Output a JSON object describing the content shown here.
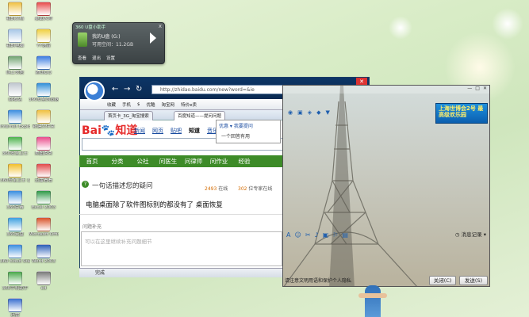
{
  "desktop": {
    "icons": [
      {
        "label": "我的文档",
        "color": "#f0c040",
        "icon": "folder-icon"
      },
      {
        "label": "桌面大师",
        "color": "#e84a4a",
        "icon": "app-icon"
      },
      {
        "label": "我的电脑",
        "color": "#a7c7e7",
        "icon": "computer-icon"
      },
      {
        "label": "YY语音",
        "color": "#f0d040",
        "icon": "yy-icon"
      },
      {
        "label": "网上邻居",
        "color": "#6fa36f",
        "icon": "network-icon"
      },
      {
        "label": "腾讯QQ",
        "color": "#3a7be0",
        "icon": "qq-icon"
      },
      {
        "label": "回收站",
        "color": "#c0c8d0",
        "icon": "recycle-bin-icon"
      },
      {
        "label": "360安全浏览器",
        "color": "#2f8fd8",
        "icon": "browser-icon"
      },
      {
        "label": "Internet Explorer",
        "color": "#3c8fe0",
        "icon": "ie-icon"
      },
      {
        "label": "新建文件夹",
        "color": "#f0c040",
        "icon": "folder-icon"
      },
      {
        "label": "360安全卫士",
        "color": "#4db34d",
        "icon": "shield-icon"
      },
      {
        "label": "美图秀秀",
        "color": "#e94c8b",
        "icon": "meitu-icon"
      },
      {
        "label": "360安全卫士 (2)",
        "color": "#f2c02c",
        "icon": "shield-icon"
      },
      {
        "label": "迅雷看看",
        "color": "#e24b4b",
        "icon": "video-icon"
      },
      {
        "label": "360杀毒",
        "color": "#3a8ee0",
        "icon": "antivirus-icon"
      },
      {
        "label": "Excel 2003",
        "color": "#2f9a49",
        "icon": "excel-icon"
      },
      {
        "label": "360云盘",
        "color": "#3da0e0",
        "icon": "cloud-icon"
      },
      {
        "label": "Microsoft Office Po...",
        "color": "#d9542b",
        "icon": "powerpoint-icon"
      },
      {
        "label": "360 cloud Start",
        "color": "#3a8ee0",
        "icon": "cloud-icon"
      },
      {
        "label": "Word 2003",
        "color": "#2b5fb8",
        "icon": "word-icon"
      },
      {
        "label": "360手机助手",
        "color": "#49a84a",
        "icon": "phone-icon"
      },
      {
        "label": "ed",
        "color": "#7a7a7a",
        "icon": "app-icon"
      },
      {
        "label": "迅雷",
        "color": "#3a6fd0",
        "icon": "thunder-icon"
      }
    ]
  },
  "widget": {
    "title": "360 U盘小助手",
    "close": "x",
    "disk_name": "我的U盘 (G:)",
    "disk_space": "可用空间：11.2GB",
    "buttons": [
      "查看",
      "退出",
      "设置"
    ]
  },
  "browser": {
    "url": "http://zhidao.baidu.com/new?word=&ie",
    "nav_back": "←",
    "nav_forward": "→",
    "nav_refresh": "↻",
    "close": "✕",
    "favorites": [
      "收藏",
      "手机",
      "$",
      "优酷",
      "淘宝网",
      "特价e卖"
    ],
    "tabs": [
      {
        "label": "首页卡_3G_淘宝搜索",
        "active": false
      },
      {
        "label": "百度知道——提问问题",
        "active": true
      }
    ],
    "dropdown_main": "我要提问",
    "dropdown_sub": "一个回答有用",
    "tab_pin": "优惠",
    "baidu_logo_bai": "Bai",
    "baidu_logo_paw": "du",
    "baidu_logo_zhidao": "知道",
    "baidu_nav": [
      "新闻",
      "网页",
      "贴吧",
      "知道",
      "音乐",
      "图片",
      "视频"
    ],
    "baidu_nav_current": "知道",
    "greenbar": [
      "首页",
      "分类",
      "公社",
      "问医生",
      "问律师",
      "问作业",
      "经验"
    ],
    "question_prompt": "一句话描述您的疑问",
    "stats": [
      {
        "num": "2493",
        "label": "在线"
      },
      {
        "num": "302",
        "label": "位专家在线"
      }
    ],
    "question_title": "电脑桌面除了软件图标别的都没有了    桌面恢复",
    "supplement_label": "问题补充",
    "supplement_placeholder": "可以在这里继续补充问题细节",
    "status": "完成"
  },
  "imwindow": {
    "winbtns": [
      "—",
      "□",
      "✕"
    ],
    "ad_text": "上海世博会2号 最高级欢乐园",
    "toolbar_icons": [
      "A",
      "☺",
      "✂",
      "♪",
      "▣",
      "⚐",
      "▤"
    ],
    "message_record": "消息记录",
    "footer_text": "请注意文明用语和保护个人隐私",
    "close_button": "关闭(C)",
    "send_button": "发送(S)"
  }
}
